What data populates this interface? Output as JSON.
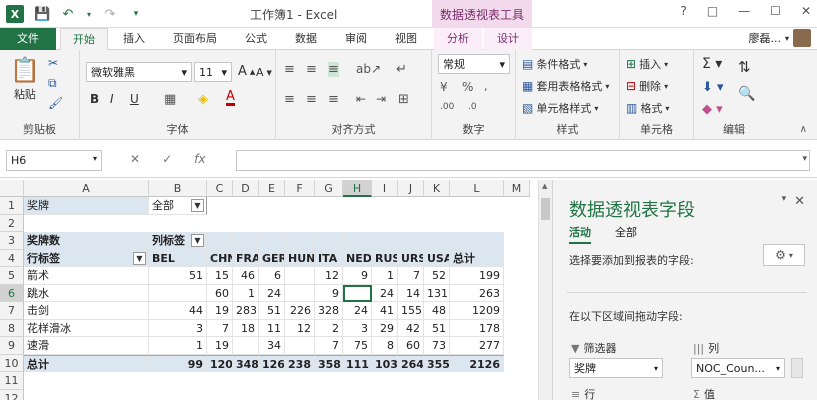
{
  "titlebar": {
    "window_title": "工作簿1 - Excel",
    "context_tab_title": "数据透视表工具",
    "minimize": "?",
    "restore": "—",
    "maximize": "☐",
    "close": "✕"
  },
  "tabs": {
    "file": "文件",
    "home": "开始",
    "insert": "插入",
    "page_layout": "页面布局",
    "formulas": "公式",
    "data": "数据",
    "review": "审阅",
    "view": "视图",
    "analyze": "分析",
    "design": "设计",
    "user_name": "廖磊..."
  },
  "ribbon": {
    "paste": "粘贴",
    "clipboard": "剪贴板",
    "font_name": "微软雅黑",
    "font_size": "11",
    "font_group": "字体",
    "align_group": "对齐方式",
    "number_format": "常规",
    "number_group": "数字",
    "conditional_format": "条件格式",
    "table_format": "套用表格格式",
    "cell_style": "单元格样式",
    "styles_group": "样式",
    "insert_cells": "插入",
    "delete_cells": "删除",
    "format_cells": "格式",
    "cells_group": "单元格",
    "editing_group": "编辑",
    "bold": "B",
    "italic": "I",
    "underline": "U"
  },
  "formula_bar": {
    "name_box": "H6",
    "cancel": "✕",
    "enter": "✓",
    "fx": "fx",
    "content": ""
  },
  "sheet": {
    "columns": [
      "A",
      "B",
      "C",
      "D",
      "E",
      "F",
      "G",
      "H",
      "I",
      "J",
      "K",
      "L",
      "M"
    ],
    "rows": [
      "1",
      "2",
      "3",
      "4",
      "5",
      "6",
      "7",
      "8",
      "9",
      "10",
      "11",
      "12"
    ],
    "a1": "奖牌",
    "b1": "全部",
    "a3": "奖牌数",
    "b3": "列标签",
    "a4": "行标签",
    "col_labels": [
      "BEL",
      "CHN",
      "FRA",
      "GER",
      "HUN",
      "ITA",
      "NED",
      "RUS",
      "URS",
      "USA",
      "总计"
    ],
    "data_rows": [
      {
        "label": "箭术",
        "values": [
          "51",
          "15",
          "46",
          "6",
          "",
          "12",
          "9",
          "1",
          "7",
          "52",
          "199"
        ]
      },
      {
        "label": "跳水",
        "values": [
          "",
          "60",
          "1",
          "24",
          "",
          "9",
          "",
          "24",
          "14",
          "131",
          "263"
        ]
      },
      {
        "label": "击剑",
        "values": [
          "44",
          "19",
          "283",
          "51",
          "226",
          "328",
          "24",
          "41",
          "155",
          "48",
          "1209"
        ]
      },
      {
        "label": "花样滑冰",
        "values": [
          "3",
          "7",
          "18",
          "11",
          "12",
          "2",
          "3",
          "29",
          "42",
          "51",
          "178"
        ]
      },
      {
        "label": "速滑",
        "values": [
          "1",
          "19",
          "",
          "34",
          "",
          "7",
          "75",
          "8",
          "60",
          "73",
          "277"
        ]
      }
    ],
    "total_row": {
      "label": "总计",
      "values": [
        "99",
        "120",
        "348",
        "126",
        "238",
        "358",
        "111",
        "103",
        "264",
        "355",
        "2126"
      ]
    }
  },
  "pane": {
    "title": "数据透视表字段",
    "tab_active": "活动",
    "tab_all": "全部",
    "choose_label": "选择要添加到报表的字段:",
    "drag_label": "在以下区域间拖动字段:",
    "filters": "筛选器",
    "columns": "列",
    "filter_value": "奖牌",
    "column_value": "NOC_Coun...",
    "rows": "行",
    "values": "值"
  }
}
